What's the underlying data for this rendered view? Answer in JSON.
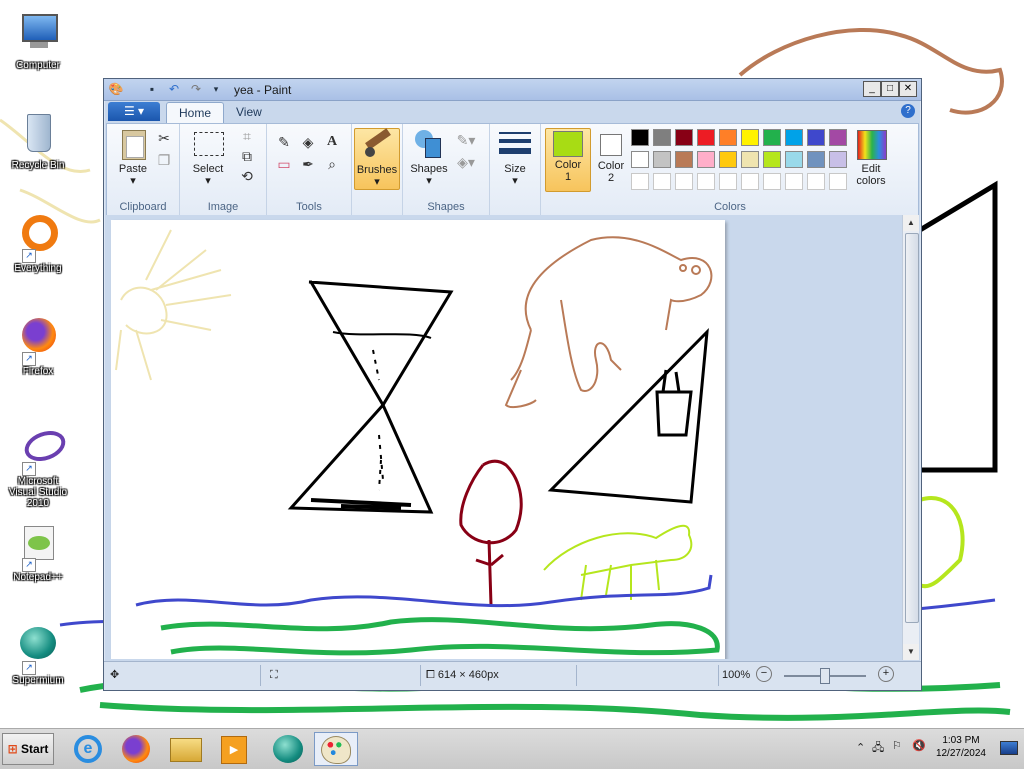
{
  "desktop": {
    "icons": [
      {
        "label": "Computer"
      },
      {
        "label": "Recycle Bin"
      },
      {
        "label": "Everything"
      },
      {
        "label": "Firefox"
      },
      {
        "label": "Microsoft Visual Studio 2010"
      },
      {
        "label": "Notepad++"
      },
      {
        "label": "Supermium"
      }
    ]
  },
  "window": {
    "title": "yea - Paint",
    "tabs": [
      {
        "label": "Home"
      },
      {
        "label": "View"
      }
    ],
    "help_icon": "help-icon"
  },
  "ribbon": {
    "clipboard": {
      "label": "Clipboard",
      "paste": "Paste"
    },
    "image": {
      "label": "Image",
      "select": "Select"
    },
    "tools": {
      "label": "Tools"
    },
    "brushes": {
      "label": "Brushes"
    },
    "shapes": {
      "label": "Shapes",
      "button": "Shapes"
    },
    "size": {
      "label": "Size"
    },
    "colors": {
      "label": "Colors",
      "color1": "Color\n1",
      "color2": "Color\n2",
      "color1_value": "#a8dc14",
      "color2_value": "#ffffff",
      "edit_colors": "Edit\ncolors",
      "palette": [
        "#000000",
        "#7f7f7f",
        "#880015",
        "#ed1c24",
        "#ff7f27",
        "#fff200",
        "#22b14c",
        "#00a2e8",
        "#3f48cc",
        "#a349a4",
        "#ffffff",
        "#c3c3c3",
        "#b97a57",
        "#ffaec9",
        "#ffc90e",
        "#efe4b0",
        "#b5e61d",
        "#99d9ea",
        "#7092be",
        "#c8bfe7",
        "#ffffff",
        "#ffffff",
        "#ffffff",
        "#ffffff",
        "#ffffff",
        "#ffffff",
        "#ffffff",
        "#ffffff",
        "#ffffff",
        "#ffffff"
      ]
    }
  },
  "status": {
    "dimensions": "614 × 460px",
    "zoom": "100%",
    "zoom_level": 1.0
  },
  "taskbar": {
    "start": "Start",
    "time": "1:03 PM",
    "date": "12/27/2024",
    "apps": [
      "internet-explorer-icon",
      "firefox-icon",
      "file-explorer-icon",
      "media-player-icon",
      "supermium-icon",
      "paint-icon"
    ]
  }
}
